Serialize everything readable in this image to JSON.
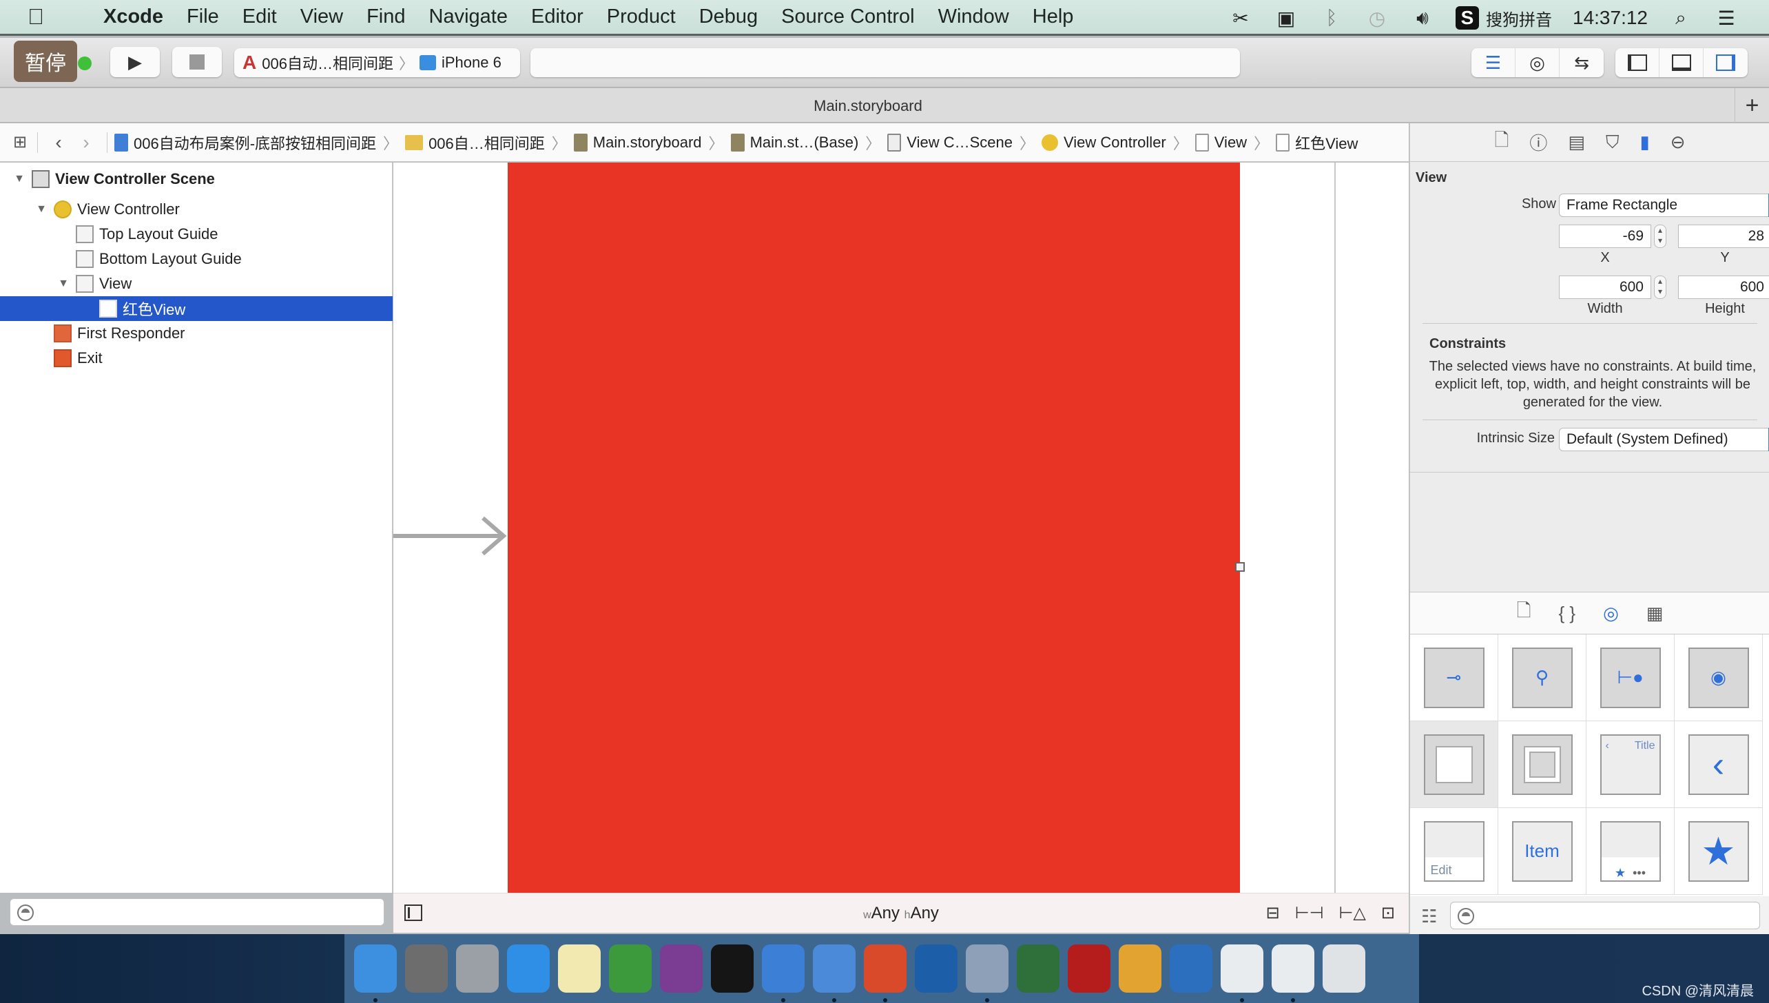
{
  "menubar": {
    "app_name": "Xcode",
    "items": [
      "File",
      "Edit",
      "View",
      "Find",
      "Navigate",
      "Editor",
      "Product",
      "Debug",
      "Source Control",
      "Window",
      "Help"
    ],
    "status": {
      "input_method": "搜狗拼音",
      "clock": "14:37:12",
      "icons": [
        "scissors-icon",
        "video-camera-icon",
        "bluetooth-icon",
        "time-machine-icon",
        "volume-icon",
        "sogou-icon",
        "spotlight-icon",
        "notification-list-icon"
      ]
    }
  },
  "toolbar": {
    "pause_badge": "暂停",
    "scheme_name": "006自动…相同间距",
    "scheme_separator": "〉",
    "device_name": "iPhone 6",
    "editor_buttons": [
      "standard-editor",
      "assistant-editor",
      "version-editor"
    ],
    "view_buttons": [
      "navigator-toggle",
      "debug-area-toggle",
      "utilities-toggle"
    ]
  },
  "tabbar": {
    "title": "Main.storyboard",
    "add_tab": "+"
  },
  "jumpbar": {
    "crumbs": [
      {
        "label": "006自动布局案例-底部按钮相同间距",
        "icon": "file"
      },
      {
        "label": "006自…相同间距",
        "icon": "folder"
      },
      {
        "label": "Main.storyboard",
        "icon": "sb"
      },
      {
        "label": "Main.st…(Base)",
        "icon": "sb"
      },
      {
        "label": "View C…Scene",
        "icon": "scene"
      },
      {
        "label": "View Controller",
        "icon": "vc"
      },
      {
        "label": "View",
        "icon": "view"
      },
      {
        "label": "红色View",
        "icon": "view"
      }
    ]
  },
  "navigator": {
    "rows": [
      {
        "label": "View Controller Scene",
        "level": 0,
        "disclosure": "▼",
        "icon": "scene",
        "bold": true
      },
      {
        "label": "View Controller",
        "level": 1,
        "disclosure": "▼",
        "icon": "vc"
      },
      {
        "label": "Top Layout Guide",
        "level": 2,
        "disclosure": "",
        "icon": "guide"
      },
      {
        "label": "Bottom Layout Guide",
        "level": 2,
        "disclosure": "",
        "icon": "guide"
      },
      {
        "label": "View",
        "level": 2,
        "disclosure": "▼",
        "icon": "view"
      },
      {
        "label": "红色View",
        "level": 3,
        "disclosure": "",
        "icon": "view",
        "selected": true
      },
      {
        "label": "First Responder",
        "level": 1,
        "disclosure": "",
        "icon": "responder"
      },
      {
        "label": "Exit",
        "level": 1,
        "disclosure": "",
        "icon": "exit"
      }
    ],
    "filter_placeholder": ""
  },
  "canvas": {
    "selected_view_color": "#e83425",
    "size_class_w_prefix": "w",
    "size_class_w": "Any",
    "size_class_h_prefix": "h",
    "size_class_h": "Any"
  },
  "inspector": {
    "section_title": "View",
    "show_label": "Show",
    "show_value": "Frame Rectangle",
    "x_value": "-69",
    "y_value": "28",
    "x_label": "X",
    "y_label": "Y",
    "width_value": "600",
    "height_value": "600",
    "width_label": "Width",
    "height_label": "Height",
    "constraints_title": "Constraints",
    "constraints_text": "The selected views have no constraints. At build time, explicit left, top, width, and height constraints will be generated for the view.",
    "intrinsic_label": "Intrinsic Size",
    "intrinsic_value": "Default (System Defined)"
  },
  "library": {
    "tabs": [
      "file-template",
      "code-snippet",
      "object",
      "media"
    ],
    "items": [
      {
        "name": "horizontal-slider-item",
        "text": ""
      },
      {
        "name": "vertical-tap-item",
        "text": ""
      },
      {
        "name": "pan-gesture-item",
        "text": ""
      },
      {
        "name": "long-press-item",
        "text": ""
      },
      {
        "name": "view-item",
        "text": ""
      },
      {
        "name": "container-view-item",
        "text": ""
      },
      {
        "name": "navigation-bar-item",
        "text": "Title"
      },
      {
        "name": "navigation-item",
        "text": ""
      },
      {
        "name": "toolbar-item",
        "text": "Edit"
      },
      {
        "name": "bar-button-item",
        "text": "Item"
      },
      {
        "name": "tab-bar-item",
        "text": ""
      },
      {
        "name": "tab-bar-item-star",
        "text": ""
      }
    ],
    "filter_placeholder": ""
  },
  "dock": {
    "apps": [
      {
        "name": "finder",
        "running": true,
        "color": "#3d8fe0"
      },
      {
        "name": "system-preferences",
        "running": false,
        "color": "#6d6d6d"
      },
      {
        "name": "launchpad",
        "running": false,
        "color": "#9aa0a6"
      },
      {
        "name": "safari",
        "running": false,
        "color": "#2f8fe6"
      },
      {
        "name": "notes",
        "running": false,
        "color": "#f2e9b0"
      },
      {
        "name": "excel",
        "running": false,
        "color": "#3c9a3c"
      },
      {
        "name": "onenote",
        "running": false,
        "color": "#7b3c93"
      },
      {
        "name": "terminal",
        "running": false,
        "color": "#151515"
      },
      {
        "name": "xcode",
        "running": true,
        "color": "#3c7fd6"
      },
      {
        "name": "simulator",
        "running": true,
        "color": "#4a8ad9"
      },
      {
        "name": "powerpoint-like",
        "running": true,
        "color": "#d94a2a"
      },
      {
        "name": "screenshot-tool",
        "running": false,
        "color": "#1c5fa8"
      },
      {
        "name": "video-app",
        "running": true,
        "color": "#8da0b8"
      },
      {
        "name": "ftp-app",
        "running": false,
        "color": "#2f6f3a"
      },
      {
        "name": "filezilla",
        "running": false,
        "color": "#b51d1d"
      },
      {
        "name": "graphics-editor",
        "running": false,
        "color": "#e2a330"
      },
      {
        "name": "word-like",
        "running": false,
        "color": "#2c6fbf"
      },
      {
        "name": "instruments-doc-1",
        "running": true,
        "color": "#e9ecef"
      },
      {
        "name": "instruments-doc-2",
        "running": true,
        "color": "#e9ecef"
      },
      {
        "name": "trash",
        "running": false,
        "color": "#dfe3e6"
      }
    ]
  },
  "watermark": "CSDN @清风清晨"
}
